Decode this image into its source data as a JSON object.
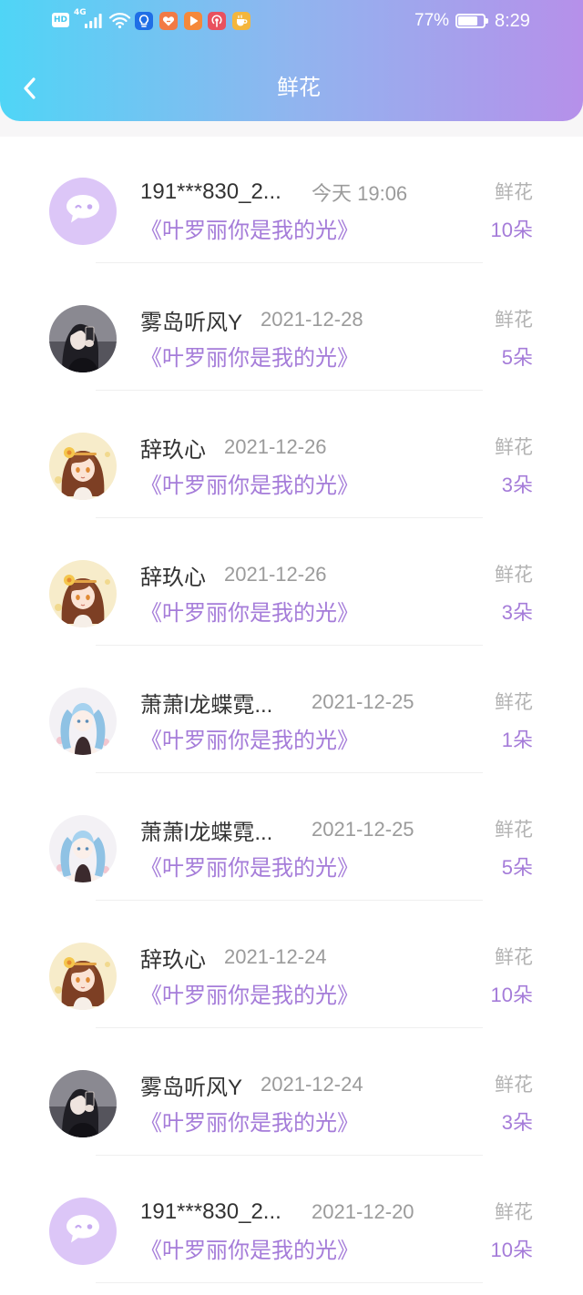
{
  "theme": {
    "header_gradient": [
      "#4fd5f6",
      "#90b5ef",
      "#b690ea"
    ],
    "accent": "#a57cd9"
  },
  "status_bar": {
    "hd_label": "HD",
    "network_label": "4G",
    "signal_icon": "signal-bars-icon",
    "wifi_icon": "wifi-icon",
    "app_icons": [
      {
        "icon": "bulb-app-icon",
        "color": "#1f6ee6"
      },
      {
        "icon": "heart-app-icon",
        "color": "#f27a45"
      },
      {
        "icon": "play-app-icon",
        "color": "#f5883a"
      },
      {
        "icon": "podcast-app-icon",
        "color": "#e9515e"
      },
      {
        "icon": "cup-app-icon",
        "color": "#f4b63c"
      }
    ],
    "battery_text": "77%",
    "battery_level": 0.77,
    "time": "8:29"
  },
  "header": {
    "back_icon": "chevron-left-icon",
    "title": "鲜花"
  },
  "gift_records": [
    {
      "avatar": "default-avatar-icon",
      "user": "191***830_2...",
      "time": "今天 19:06",
      "work": "《叶罗丽你是我的光》",
      "gift_label": "鲜花",
      "count": "10朵"
    },
    {
      "avatar": "avatar-dark-hair-girl",
      "user": "雾岛听风Y",
      "time": "2021-12-28",
      "work": "《叶罗丽你是我的光》",
      "gift_label": "鲜花",
      "count": "5朵"
    },
    {
      "avatar": "avatar-brown-hair-girl",
      "user": "辞玖心",
      "time": "2021-12-26",
      "work": "《叶罗丽你是我的光》",
      "gift_label": "鲜花",
      "count": "3朵"
    },
    {
      "avatar": "avatar-brown-hair-girl",
      "user": "辞玖心",
      "time": "2021-12-26",
      "work": "《叶罗丽你是我的光》",
      "gift_label": "鲜花",
      "count": "3朵"
    },
    {
      "avatar": "avatar-blue-hair-girl",
      "user": "萧萧l龙蝶霓...",
      "time": "2021-12-25",
      "work": "《叶罗丽你是我的光》",
      "gift_label": "鲜花",
      "count": "1朵"
    },
    {
      "avatar": "avatar-blue-hair-girl",
      "user": "萧萧l龙蝶霓...",
      "time": "2021-12-25",
      "work": "《叶罗丽你是我的光》",
      "gift_label": "鲜花",
      "count": "5朵"
    },
    {
      "avatar": "avatar-brown-hair-girl",
      "user": "辞玖心",
      "time": "2021-12-24",
      "work": "《叶罗丽你是我的光》",
      "gift_label": "鲜花",
      "count": "10朵"
    },
    {
      "avatar": "avatar-dark-hair-girl",
      "user": "雾岛听风Y",
      "time": "2021-12-24",
      "work": "《叶罗丽你是我的光》",
      "gift_label": "鲜花",
      "count": "3朵"
    },
    {
      "avatar": "default-avatar-icon",
      "user": "191***830_2...",
      "time": "2021-12-20",
      "work": "《叶罗丽你是我的光》",
      "gift_label": "鲜花",
      "count": "10朵"
    }
  ]
}
